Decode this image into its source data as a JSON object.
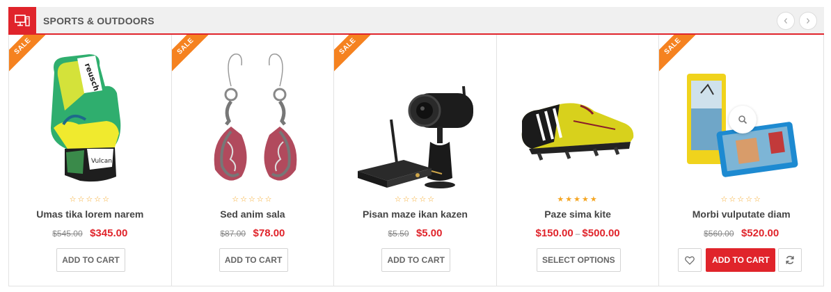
{
  "header": {
    "title": "SPORTS & OUTDOORS",
    "icon": "computer-monitor-icon",
    "accent": "#e0242b"
  },
  "nav": {
    "prev_icon": "chevron-left-icon",
    "next_icon": "chevron-right-icon"
  },
  "sale_label": "SALE",
  "products": [
    {
      "name": "Umas tika lorem narem",
      "old_price": "$545.00",
      "price": "$345.00",
      "stars": "☆☆☆☆☆",
      "button": "ADD TO CART"
    },
    {
      "name": "Sed anim sala",
      "old_price": "$87.00",
      "price": "$78.00",
      "stars": "☆☆☆☆☆",
      "button": "ADD TO CART"
    },
    {
      "name": "Pisan maze ikan kazen",
      "old_price": "$5.50",
      "price": "$5.00",
      "stars": "☆☆☆☆☆",
      "button": "ADD TO CART"
    },
    {
      "name": "Paze sima kite",
      "price_from": "$150.00",
      "price_sep": "–",
      "price_to": "$500.00",
      "stars": "★★★★★",
      "button": "SELECT OPTIONS"
    },
    {
      "name": "Morbi vulputate diam",
      "old_price": "$560.00",
      "price": "$520.00",
      "stars": "☆☆☆☆☆",
      "button": "ADD TO CART"
    }
  ],
  "colors": {
    "sale": "#f58220",
    "price": "#e0242b",
    "stars": "#f5a623"
  }
}
